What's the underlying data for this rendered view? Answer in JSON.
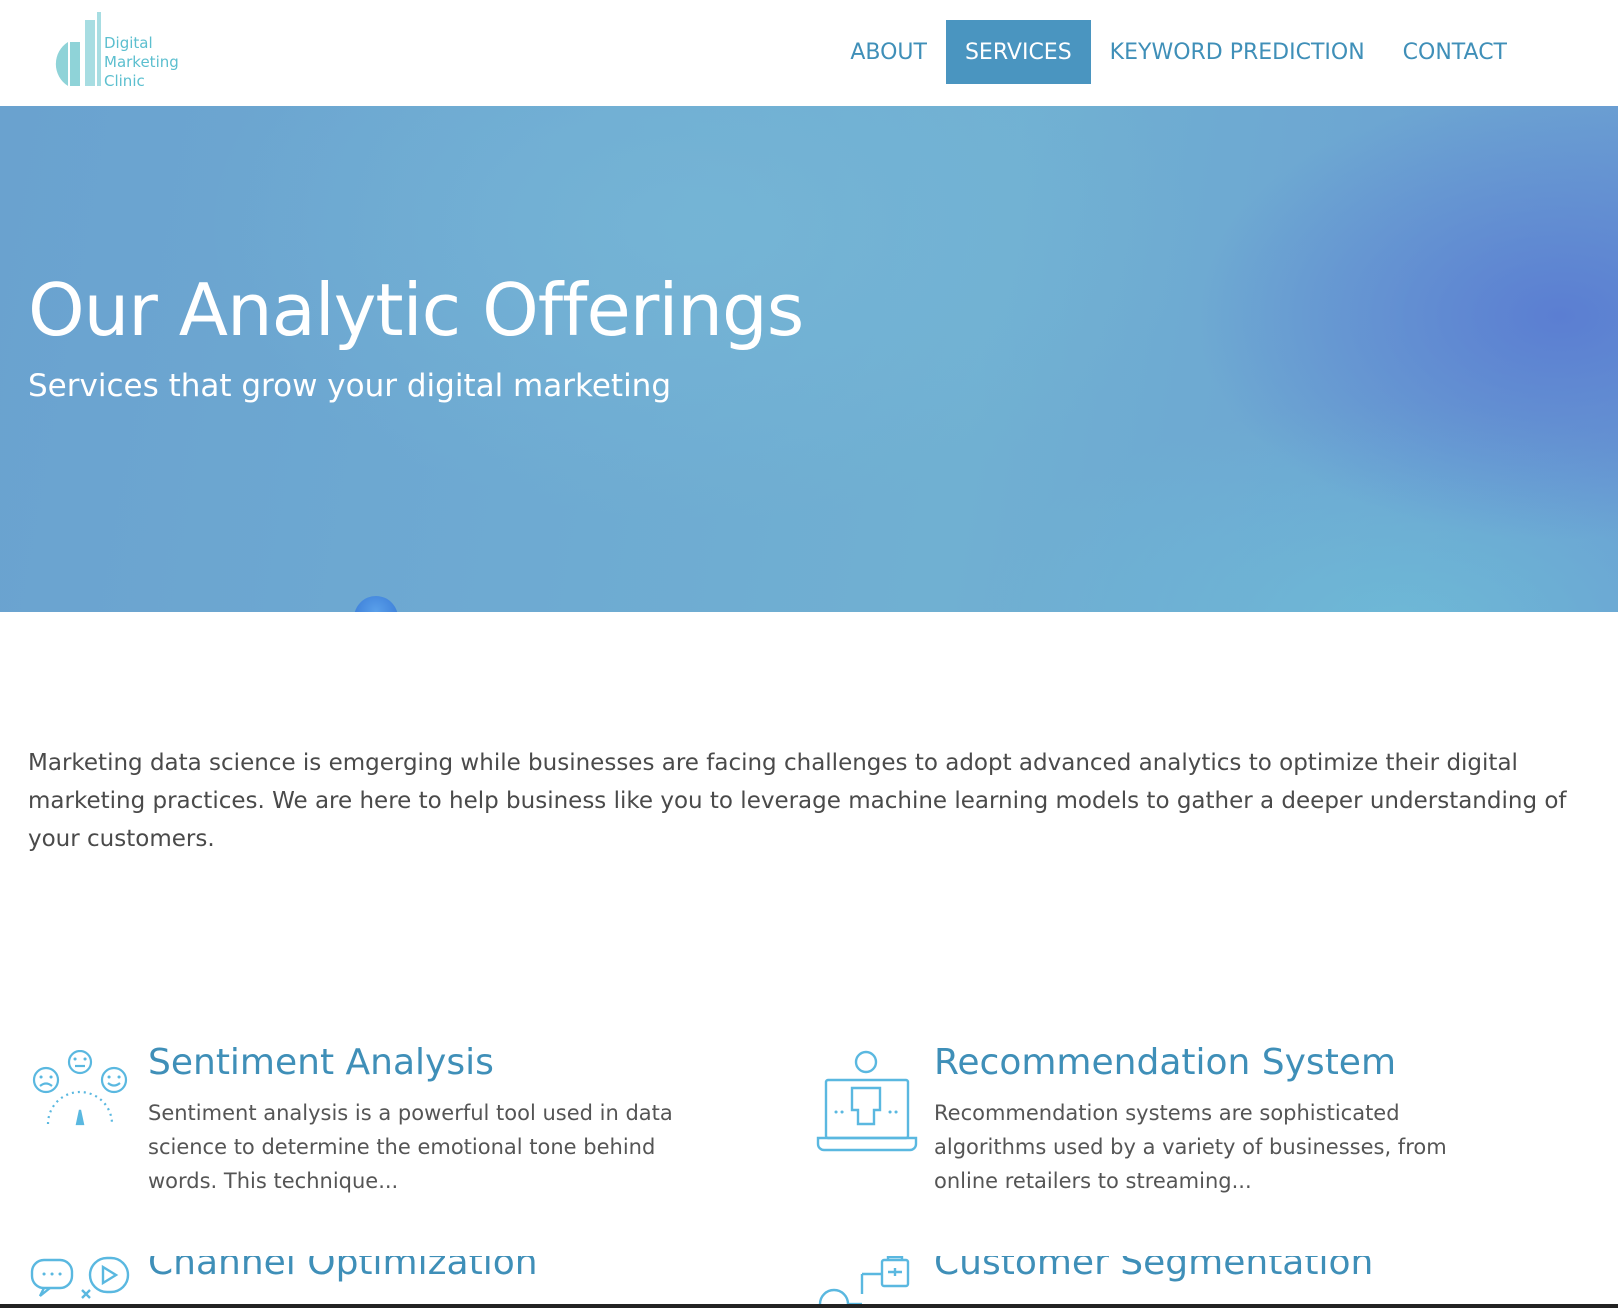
{
  "brand": {
    "logo_line1": "Digital",
    "logo_line2": "Marketing",
    "logo_line3": "Clinic",
    "accent_color": "#5cbfcf",
    "link_color": "#3f8fb8"
  },
  "nav": {
    "items": [
      {
        "label": "ABOUT"
      },
      {
        "label": "SERVICES",
        "active": true
      },
      {
        "label": "KEYWORD PREDICTION"
      },
      {
        "label": "CONTACT"
      }
    ]
  },
  "hero": {
    "title": "Our Analytic Offerings",
    "subtitle": "Services that grow your digital marketing"
  },
  "intro": {
    "text": "Marketing data science is emgerging while businesses are facing challenges to adopt advanced analytics to optimize their digital marketing practices. We are here to help business like you to leverage machine learning models to gather a deeper understanding of your customers."
  },
  "services": [
    {
      "title": "Sentiment Analysis",
      "description": "Sentiment analysis is a powerful tool used in data science to determine the emotional tone behind words. This technique...",
      "icon": "sentiment-faces-icon"
    },
    {
      "title": "Recommendation System",
      "description": "Recommendation systems are sophisticated algorithms used by a variety of businesses, from online retailers to streaming...",
      "icon": "laptop-user-icon"
    },
    {
      "title": "Channel Optimization",
      "description": "",
      "icon": "chat-channels-icon"
    },
    {
      "title": "Customer Segmentation",
      "description": "",
      "icon": "segmentation-icon"
    }
  ]
}
